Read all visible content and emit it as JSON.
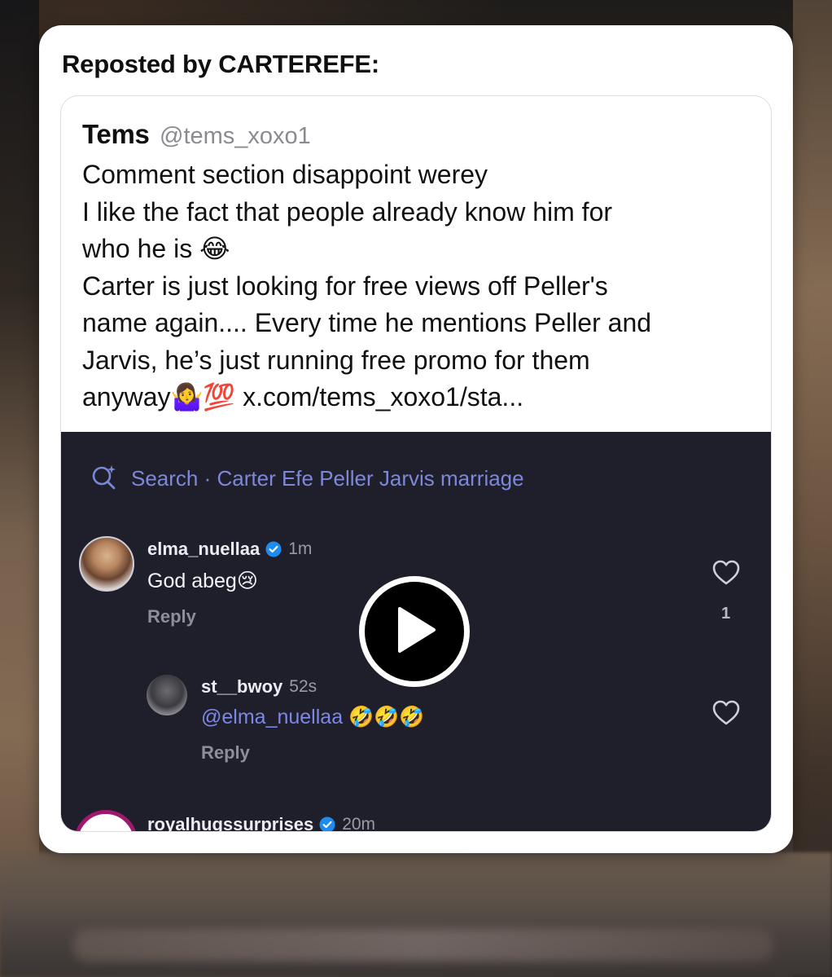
{
  "header": {
    "title": "Reposted by CARTEREFE:"
  },
  "quoted_post": {
    "author_name": "Tems",
    "author_handle": "@tems_xoxo1",
    "lines": [
      "Comment section disappoint werey",
      "I like the fact that people already know him for",
      "who he is 😂",
      "Carter is just looking for free views off Peller's",
      "name again.... Every time he mentions Peller and",
      "Jarvis, he’s just running free promo for them"
    ],
    "last_line_prefix": "anyway🤷‍♀️💯",
    "link": "x.com/tems_xoxo1/sta..."
  },
  "media": {
    "search_label": "Search · Carter Efe Peller Jarvis marriage",
    "comments": [
      {
        "username": "elma_nuellaa",
        "time": "1m",
        "text": "God abeg😢",
        "reply_label": "Reply",
        "like_count": "1"
      },
      {
        "username": "st__bwoy",
        "time": "52s",
        "mention": "@elma_nuellaa",
        "text": "🤣🤣🤣",
        "reply_label": "Reply"
      },
      {
        "username": "royalhugssurprises",
        "time": "20m"
      }
    ]
  },
  "colors": {
    "media_bg": "#1f1f2b",
    "accent_blue": "#7d88e6",
    "verified_blue": "#1d8cf0"
  },
  "icons": [
    "search-sparkle-icon",
    "verified-badge-icon",
    "heart-icon",
    "play-icon"
  ]
}
